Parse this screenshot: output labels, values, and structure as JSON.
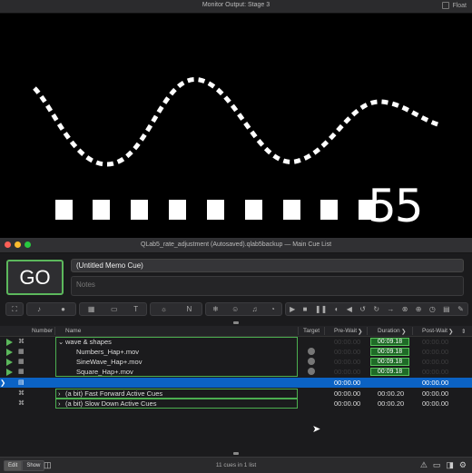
{
  "monitor": {
    "title": "Monitor Output: Stage 3",
    "float_label": "Float",
    "counter_text": "55"
  },
  "window": {
    "title": "QLab5_rate_adjustment (Autosaved).qlab5backup — Main Cue List"
  },
  "go_button": {
    "label": "GO"
  },
  "cue_name_field": {
    "value": "(Untitled Memo Cue)"
  },
  "notes_field": {
    "placeholder": "Notes"
  },
  "toolbar_icons": [
    "fullscreen-icon",
    "audio-icon",
    "mic-icon",
    "video-icon",
    "camera-icon",
    "text-icon",
    "light-icon",
    "network-icon",
    "timecode-icon",
    "midi-icon",
    "fade-icon",
    "group-icon",
    "play-icon",
    "stop-icon",
    "pause-icon",
    "load-icon",
    "reset-icon",
    "devamp-icon",
    "goto-icon",
    "target-icon",
    "arm-icon",
    "disarm-icon",
    "wait-icon",
    "memo-icon",
    "script-icon"
  ],
  "table": {
    "headers": {
      "number": "Number",
      "name": "Name",
      "target": "Target",
      "prewait": "Pre-Wait",
      "duration": "Duration",
      "postwait": "Post-Wait"
    },
    "rows": [
      {
        "type": "group",
        "name": "wave & shapes",
        "prewait": "00:00.00",
        "duration": "00:09.18",
        "postwait": "00:00.00"
      },
      {
        "type": "video",
        "name": "Numbers_Hap+.mov",
        "prewait": "00:00.00",
        "duration": "00:09.18",
        "postwait": "00:00.00"
      },
      {
        "type": "video",
        "name": "SineWave_Hap+.mov",
        "prewait": "00:00.00",
        "duration": "00:09.18",
        "postwait": "00:00.00"
      },
      {
        "type": "video",
        "name": "Square_Hap+.mov",
        "prewait": "00:00.00",
        "duration": "00:09.18",
        "postwait": "00:00.00"
      },
      {
        "type": "memo",
        "name": "",
        "prewait": "00:00.00",
        "duration": "",
        "postwait": "00:00.00"
      },
      {
        "type": "group",
        "name": "(a bit) Fast Forward Active Cues",
        "prewait": "00:00.00",
        "duration": "00:00.20",
        "postwait": "00:00.00"
      },
      {
        "type": "group",
        "name": "(a bit) Slow Down Active Cues",
        "prewait": "00:00.00",
        "duration": "00:00.20",
        "postwait": "00:00.00"
      }
    ]
  },
  "statusbar": {
    "edit_label": "Edit",
    "show_label": "Show",
    "cue_count": "11 cues in 1 list"
  },
  "colors": {
    "accent_green": "#5cb85c",
    "selection_blue": "#0b62c4"
  }
}
